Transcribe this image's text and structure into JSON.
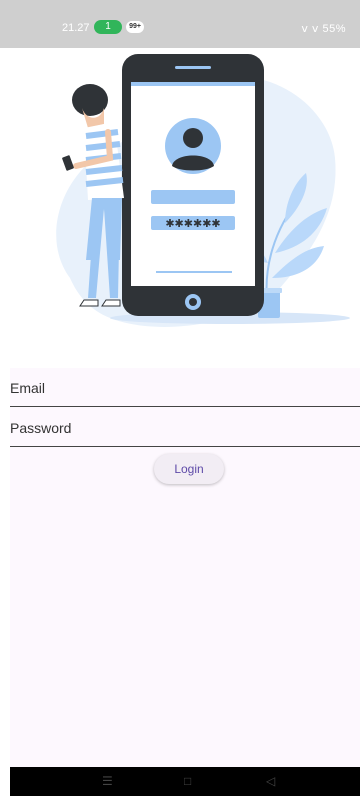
{
  "status": {
    "time": "21.27",
    "pill": "1",
    "badge": "99+",
    "right": "ⅴ ⅴ 55%"
  },
  "form": {
    "email_label": "Email",
    "password_label": "Password",
    "login_label": "Login"
  },
  "illustration": {
    "password_mask": "✱✱✱✱✱✱"
  },
  "nav": {
    "menu": "☰",
    "home": "□",
    "back": "◁"
  }
}
